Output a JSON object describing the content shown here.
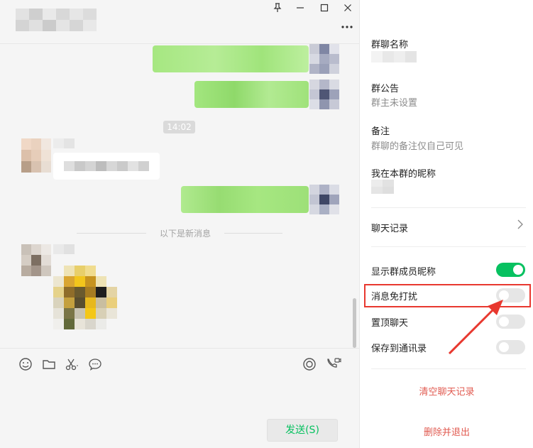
{
  "chat": {
    "time_chip": "14:02",
    "new_messages_divider": "以下是新消息",
    "send_label": "发送(S)"
  },
  "window_buttons": {
    "pin": "pin-icon",
    "minimize": "minimize-icon",
    "maximize": "maximize-icon",
    "close": "close-icon",
    "more": "more-icon"
  },
  "toolbar": {
    "icons": [
      "emoji-icon",
      "folder-icon",
      "scissors-icon",
      "chat-bubble-icon",
      "live-icon",
      "video-call-icon"
    ]
  },
  "settings": {
    "group_name_label": "群聊名称",
    "announcement_label": "群公告",
    "announcement_value": "群主未设置",
    "remark_label": "备注",
    "remark_value": "群聊的备注仅自己可见",
    "my_nickname_label": "我在本群的昵称",
    "chat_history_label": "聊天记录",
    "toggles": [
      {
        "label": "显示群成员昵称",
        "on": true
      },
      {
        "label": "消息免打扰",
        "on": false
      },
      {
        "label": "置顶聊天",
        "on": false
      },
      {
        "label": "保存到通讯录",
        "on": false
      }
    ],
    "clear_history": "清空聊天记录",
    "delete_and_exit": "删除并退出"
  },
  "colors": {
    "accent_green": "#07c160",
    "bubble_green": "#a6e781",
    "danger_red": "#e15b51",
    "annotation_red": "#e8382f"
  }
}
